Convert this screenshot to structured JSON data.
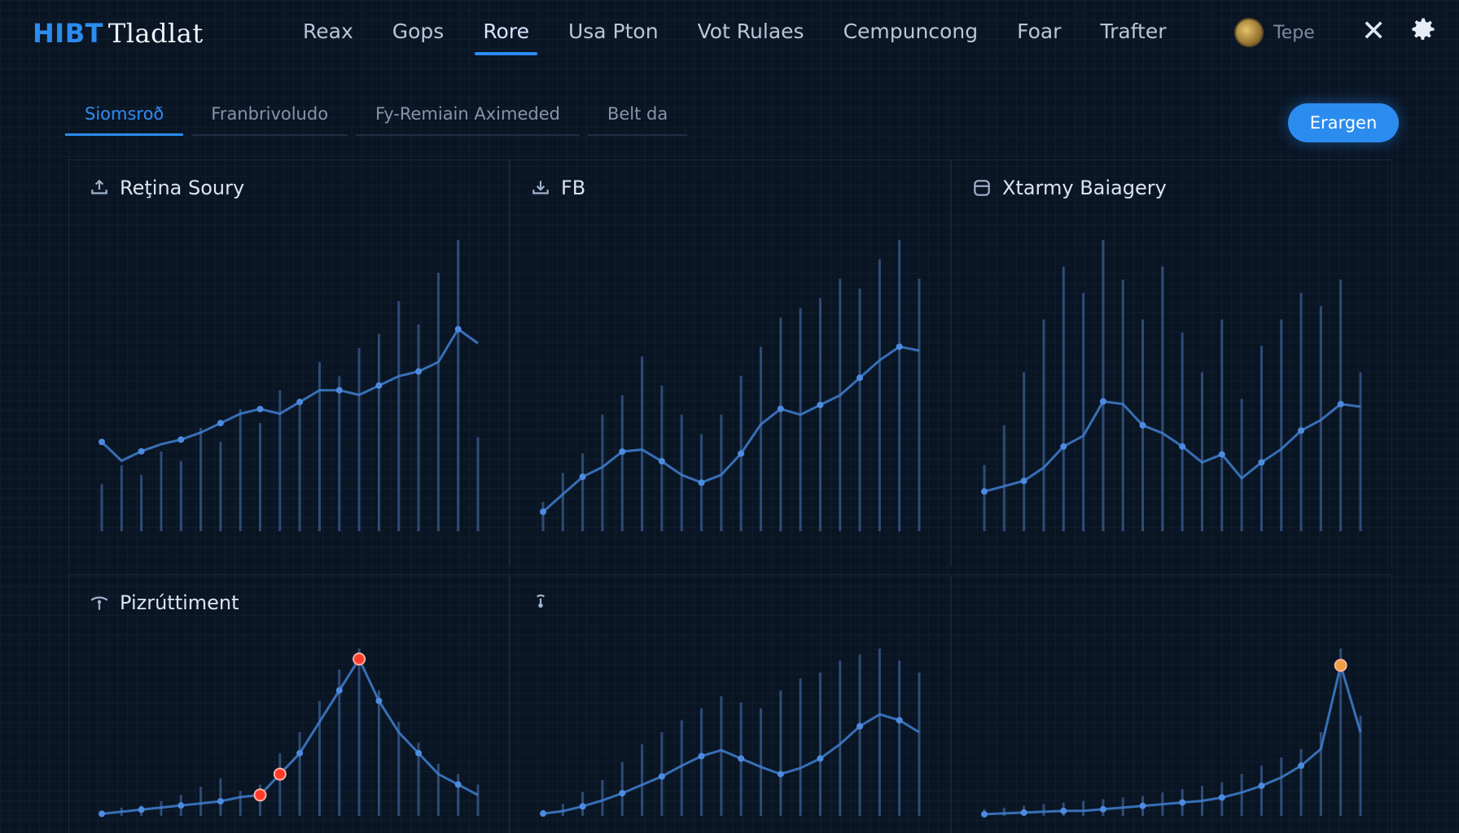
{
  "brand": {
    "prefix": "HIBT",
    "name": "Tladlat"
  },
  "nav": {
    "items": [
      "Reax",
      "Gops",
      "Rore",
      "Usa Pton",
      "Vot Rulaes",
      "Cempuncong",
      "Foar",
      "Trafter"
    ],
    "active_index": 2
  },
  "user": {
    "name": "Tepe"
  },
  "icons": {
    "close": "close-icon",
    "settings": "gear-icon",
    "avatar": "avatar"
  },
  "subtabs": {
    "items": [
      "Siomsroð",
      "Franbrivoludo",
      "Fy-Remiain Aximeded",
      "Belt da"
    ],
    "active_index": 0
  },
  "actions": {
    "primary_label": "Erargen"
  },
  "colors": {
    "accent": "#2b8cf0",
    "background": "#0a1524",
    "line": "#3f7fd0",
    "bar": "#4a78b8",
    "highlight_red": "#ff3b2a",
    "highlight_orange": "#f0a040"
  },
  "panels": [
    {
      "title": "Reţina Soury",
      "icon": "upload-tray-icon"
    },
    {
      "title": "FB",
      "icon": "download-tray-icon"
    },
    {
      "title": "Xtarmy Baiagery",
      "icon": "database-icon"
    },
    {
      "title": "Pizrúttiment",
      "icon": "antenna-icon"
    },
    {
      "title": "",
      "icon": "signal-icon"
    },
    {
      "title": "",
      "icon": ""
    }
  ],
  "chart_data": [
    {
      "type": "line",
      "x": [
        1,
        2,
        3,
        4,
        5,
        6,
        7,
        8,
        9,
        10,
        11,
        12,
        13,
        14,
        15,
        16,
        17,
        18,
        19,
        20
      ],
      "series": [
        {
          "values": [
            38,
            30,
            34,
            37,
            39,
            42,
            46,
            50,
            52,
            50,
            55,
            60,
            60,
            58,
            62,
            66,
            68,
            72,
            86,
            80
          ]
        }
      ],
      "bar_values": [
        20,
        28,
        24,
        34,
        30,
        44,
        38,
        52,
        46,
        60,
        55,
        72,
        66,
        78,
        84,
        98,
        88,
        110,
        124,
        40
      ]
    },
    {
      "type": "line",
      "x": [
        1,
        2,
        3,
        4,
        5,
        6,
        7,
        8,
        9,
        10,
        11,
        12,
        13,
        14,
        15,
        16,
        17,
        18,
        19,
        20
      ],
      "series": [
        {
          "values": [
            20,
            38,
            56,
            66,
            82,
            84,
            72,
            58,
            50,
            58,
            80,
            110,
            126,
            120,
            130,
            140,
            158,
            176,
            190,
            186
          ]
        }
      ],
      "bar_values": [
        30,
        60,
        80,
        120,
        140,
        180,
        150,
        120,
        100,
        120,
        160,
        190,
        220,
        230,
        240,
        260,
        250,
        280,
        300,
        260
      ]
    },
    {
      "type": "line",
      "x": [
        1,
        2,
        3,
        4,
        5,
        6,
        7,
        8,
        9,
        10,
        11,
        12,
        13,
        14,
        15,
        16,
        17,
        18,
        19,
        20
      ],
      "series": [
        {
          "values": [
            30,
            34,
            38,
            48,
            64,
            72,
            98,
            96,
            80,
            74,
            64,
            52,
            58,
            40,
            52,
            62,
            76,
            84,
            96,
            94
          ]
        }
      ],
      "bar_values": [
        50,
        80,
        120,
        160,
        200,
        180,
        220,
        190,
        160,
        200,
        150,
        120,
        160,
        100,
        140,
        160,
        180,
        170,
        190,
        120
      ]
    },
    {
      "type": "line",
      "x": [
        1,
        2,
        3,
        4,
        5,
        6,
        7,
        8,
        9,
        10,
        11,
        12,
        13,
        14,
        15,
        16,
        17,
        18,
        19,
        20
      ],
      "series": [
        {
          "values": [
            2,
            4,
            6,
            8,
            10,
            12,
            14,
            18,
            20,
            40,
            60,
            90,
            120,
            150,
            110,
            80,
            60,
            40,
            30,
            20
          ]
        }
      ],
      "bar_values": [
        4,
        8,
        10,
        14,
        20,
        28,
        36,
        24,
        30,
        60,
        80,
        110,
        140,
        160,
        120,
        90,
        70,
        50,
        40,
        30
      ],
      "highlights": [
        {
          "index": 8,
          "color": "red"
        },
        {
          "index": 9,
          "color": "red"
        },
        {
          "index": 13,
          "color": "red"
        }
      ]
    },
    {
      "type": "line",
      "x": [
        1,
        2,
        3,
        4,
        5,
        6,
        7,
        8,
        9,
        10,
        11,
        12,
        13,
        14,
        15,
        16,
        17,
        18,
        19,
        20
      ],
      "series": [
        {
          "values": [
            4,
            8,
            16,
            26,
            38,
            52,
            66,
            84,
            100,
            110,
            96,
            82,
            70,
            80,
            96,
            120,
            150,
            170,
            160,
            140
          ]
        }
      ],
      "bar_values": [
        10,
        20,
        40,
        60,
        90,
        120,
        140,
        160,
        180,
        200,
        190,
        180,
        210,
        230,
        240,
        260,
        270,
        280,
        260,
        240
      ]
    },
    {
      "type": "line",
      "x": [
        1,
        2,
        3,
        4,
        5,
        6,
        7,
        8,
        9,
        10,
        11,
        12,
        13,
        14,
        15,
        16,
        17,
        18,
        19,
        20
      ],
      "series": [
        {
          "values": [
            2,
            3,
            4,
            5,
            6,
            6,
            8,
            10,
            12,
            14,
            16,
            18,
            22,
            28,
            36,
            46,
            60,
            80,
            180,
            100
          ]
        }
      ],
      "bar_values": [
        8,
        10,
        12,
        14,
        16,
        18,
        20,
        22,
        24,
        28,
        32,
        36,
        40,
        50,
        60,
        70,
        80,
        100,
        200,
        120
      ],
      "highlights": [
        {
          "index": 18,
          "color": "orange"
        }
      ]
    }
  ]
}
